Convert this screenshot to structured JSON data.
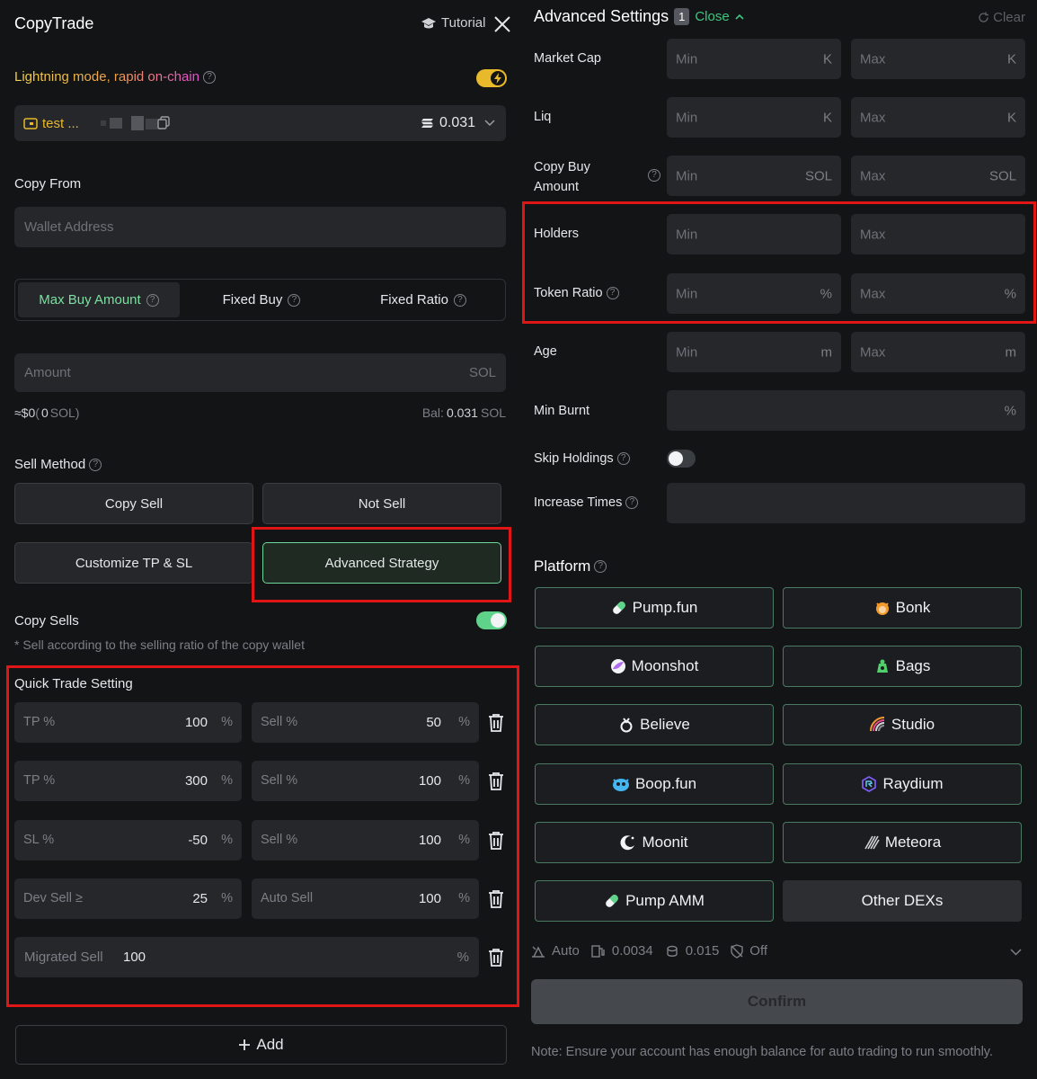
{
  "left": {
    "title": "CopyTrade",
    "tutorial": "Tutorial",
    "lightning": "Lightning mode, rapid on-chain",
    "wallet_name": "test ...",
    "balance_display": "0.031",
    "copy_from_label": "Copy From",
    "wallet_placeholder": "Wallet Address",
    "buy_tabs": [
      "Max Buy Amount",
      "Fixed Buy",
      "Fixed Ratio"
    ],
    "amount_placeholder": "Amount",
    "amount_unit": "SOL",
    "approx_prefix": "≈$0",
    "approx_paren_open": "(",
    "approx_value": "0",
    "approx_unit": "SOL",
    "approx_paren_close": ")",
    "bal_label": "Bal:",
    "bal_value": "0.031",
    "bal_unit": "SOL",
    "sell_method_label": "Sell Method",
    "sell_buttons": [
      "Copy Sell",
      "Not Sell",
      "Customize TP & SL",
      "Advanced Strategy"
    ],
    "copy_sells_label": "Copy Sells",
    "copy_sells_note": "* Sell according to the selling ratio of the copy wallet",
    "quick_trade_label": "Quick Trade Setting",
    "rows": [
      {
        "a_label": "TP %",
        "a_value": "100",
        "a_unit": "%",
        "b_label": "Sell %",
        "b_value": "50",
        "b_unit": "%"
      },
      {
        "a_label": "TP %",
        "a_value": "300",
        "a_unit": "%",
        "b_label": "Sell %",
        "b_value": "100",
        "b_unit": "%"
      },
      {
        "a_label": "SL %",
        "a_value": "-50",
        "a_unit": "%",
        "b_label": "Sell %",
        "b_value": "100",
        "b_unit": "%"
      },
      {
        "a_label": "Dev Sell ≥",
        "a_value": "25",
        "a_unit": "%",
        "b_label": "Auto Sell",
        "b_value": "100",
        "b_unit": "%"
      }
    ],
    "migrated_label": "Migrated Sell",
    "migrated_value": "100",
    "migrated_unit": "%",
    "add_label": "Add"
  },
  "right": {
    "title": "Advanced Settings",
    "count_badge": "1",
    "close_label": "Close",
    "clear_label": "Clear",
    "filters": [
      {
        "label": "Market Cap",
        "min": "Min",
        "min_unit": "K",
        "max": "Max",
        "max_unit": "K"
      },
      {
        "label": "Liq",
        "min": "Min",
        "min_unit": "K",
        "max": "Max",
        "max_unit": "K"
      },
      {
        "label": "Copy Buy Amount",
        "label_line1": "Copy Buy",
        "label_line2": "Amount",
        "min": "Min",
        "min_unit": "SOL",
        "max": "Max",
        "max_unit": "SOL"
      },
      {
        "label": "Holders",
        "min": "Min",
        "min_unit": "",
        "max": "Max",
        "max_unit": ""
      },
      {
        "label": "Token Ratio",
        "min": "Min",
        "min_unit": "%",
        "max": "Max",
        "max_unit": "%"
      },
      {
        "label": "Age",
        "min": "Min",
        "min_unit": "m",
        "max": "Max",
        "max_unit": "m"
      }
    ],
    "min_burnt_label": "Min Burnt",
    "min_burnt_unit": "%",
    "skip_holdings_label": "Skip Holdings",
    "increase_times_label": "Increase Times",
    "platform_label": "Platform",
    "platforms": [
      "Pump.fun",
      "Bonk",
      "Moonshot",
      "Bags",
      "Believe",
      "Studio",
      "Boop.fun",
      "Raydium",
      "Moonit",
      "Meteora",
      "Pump AMM",
      "Other DEXs"
    ],
    "footer_auto": "Auto",
    "footer_gas": "0.0034",
    "footer_tip": "0.015",
    "footer_mev": "Off",
    "confirm_label": "Confirm",
    "note": "Note: Ensure your account has enough balance for auto trading to run smoothly."
  },
  "colors": {
    "accent_green": "#7be0a0",
    "lightning_gradient_start": "#f5d548",
    "lightning_gradient_end": "#e84bd9",
    "toggle_yellow": "#e8b92a",
    "toggle_green": "#5fd38a",
    "highlight_red": "#e01515",
    "close_green": "#3ec77e"
  }
}
